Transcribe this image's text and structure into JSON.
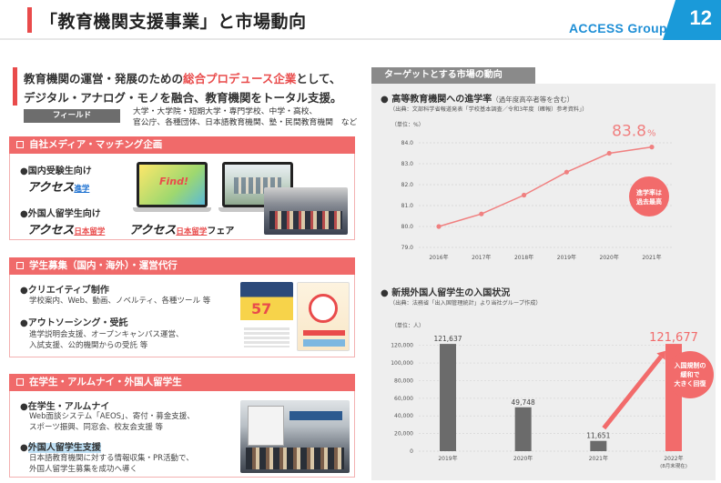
{
  "header": {
    "title": "「教育機関支援事業」と市場動向",
    "logo": "ACCESS Group",
    "page_number": "12"
  },
  "intro": {
    "line1_pre": "教育機関の運営・発展のための",
    "line1_hl": "総合プロデュース企業",
    "line1_post": "として、",
    "line2": "デジタル・アナログ・モノを融合、教育機関をトータル支援。",
    "field_label": "フィールド",
    "field_line1": "大学・大学院・短期大学・専門学校、中学・高校、",
    "field_line2": "官公庁、各種団体、日本語教育機関、塾・民間教育機関　など"
  },
  "section1": {
    "title": "自社メディア・マッチング企画",
    "bullet1": "●国内受験生向け",
    "brand1": "アクセス",
    "brand1_sub": "進学",
    "bullet2": "●外国人留学生向け",
    "brand2": "アクセス",
    "brand2_sub": "日本留学",
    "brand3": "アクセス",
    "brand3_sub": "日本留学",
    "brand3_tail": "フェア",
    "screen_text": "Find!"
  },
  "section2": {
    "title": "学生募集（国内・海外）・運営代行",
    "bullet1": "●クリエイティブ制作",
    "text1": "学校案内、Web、動画、ノベルティ、各種ツール 等",
    "bullet2": "●アウトソーシング・受託",
    "text2a": "進学説明会支援、オープンキャンパス運営、",
    "text2b": "入試支援、公的機関からの受託 等",
    "poster_num": "57"
  },
  "section3": {
    "title": "在学生・アルムナイ・外国人留学生",
    "bullet1": "●在学生・アルムナイ",
    "text1a": "Web面談システム「AEOS」、寄付・募金支援、",
    "text1b": "スポーツ振興、同窓会、校友会支援 等",
    "bullet2_dot": "●",
    "bullet2": "外国人留学生支援",
    "text2a": "日本語教育機関に対する情報収集・PR活動で、",
    "text2b": "外国人留学生募集を成功へ導く"
  },
  "market": {
    "heading": "ターゲットとする市場の動向"
  },
  "chart_data": [
    {
      "type": "line",
      "title": "高等教育機関への進学率",
      "note": "（過年度高卒者等を含む）",
      "source": "（出典：文部科学省報道発表「学校基本調査／令和3年度（確報）参考資料」）",
      "unit": "（単位：%）",
      "categories": [
        "2016年",
        "2017年",
        "2018年",
        "2019年",
        "2020年",
        "2021年"
      ],
      "values": [
        80.0,
        80.6,
        81.5,
        82.6,
        83.5,
        83.8
      ],
      "yticks": [
        "79.0",
        "80.0",
        "81.0",
        "82.0",
        "83.0",
        "84.0"
      ],
      "ylim": [
        79.0,
        84.0
      ],
      "highlight_value": "83.8",
      "highlight_unit": "%",
      "callout": [
        "進学率は",
        "過去最高"
      ],
      "color": "#f08080"
    },
    {
      "type": "bar",
      "title": "新規外国人留学生の入国状況",
      "source": "（出典：法務省「出入国管理統計」より当社グループ作成）",
      "unit": "（単位：人）",
      "categories": [
        "2019年",
        "2020年",
        "2021年",
        "2022年"
      ],
      "category_notes": [
        "",
        "",
        "",
        "(8月末現在)"
      ],
      "values": [
        121637,
        49748,
        11651,
        121677
      ],
      "value_labels": [
        "121,637",
        "49,748",
        "11,651",
        "121,677"
      ],
      "yticks": [
        "0",
        "20,000",
        "40,000",
        "60,000",
        "80,000",
        "100,000",
        "120,000"
      ],
      "ylim": [
        0,
        130000
      ],
      "callout": [
        "入国規制の",
        "緩和で",
        "大きく回復"
      ],
      "bar_color": "#6b6b6b",
      "highlight_color": "#f26b6b"
    }
  ]
}
